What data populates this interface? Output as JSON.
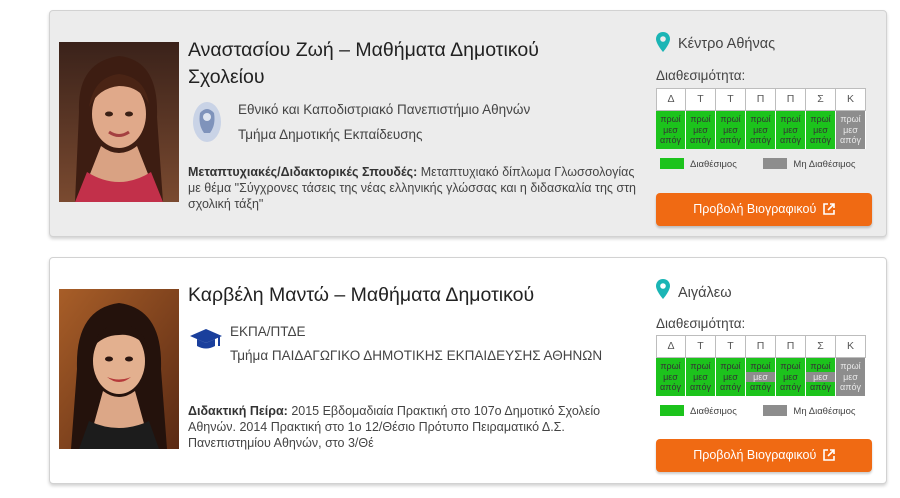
{
  "tutors": [
    {
      "name": "Αναστασίου Ζωή – Μαθήματα Δημοτικού Σχολείου",
      "university": "Εθνικό και Καποδιστριακό Πανεπιστήμιο Αθηνών",
      "department": "Τμήμα Δημοτικής Εκπαίδευσης",
      "description_label": "Μεταπτυχιακές/Διδακτορικές Σπουδές:",
      "description_text": " Μεταπτυχιακό δίπλωμα Γλωσσολογίας με θέμα \"Σύγχρονες τάσεις της νέας ελληνικής γλώσσας και η διδασκαλία της στη σχολική τάξη\"",
      "location": "Κέντρο Αθήνας",
      "availability_label": "Διαθεσιμότητα:",
      "days": [
        "Δ",
        "Τ",
        "Τ",
        "Π",
        "Π",
        "Σ",
        "Κ"
      ],
      "slots": [
        [
          "πρωί",
          "μεσ",
          "απόγ"
        ],
        [
          "πρωί",
          "μεσ",
          "απόγ"
        ],
        [
          "πρωί",
          "μεσ",
          "απόγ"
        ],
        [
          "πρωί",
          "μεσ",
          "απόγ"
        ],
        [
          "πρωί",
          "μεσ",
          "απόγ"
        ],
        [
          "πρωί",
          "μεσ",
          "απόγ"
        ],
        [
          "πρωί",
          "μεσ",
          "απόγ"
        ]
      ],
      "slot_states": [
        [
          1,
          1,
          1
        ],
        [
          1,
          1,
          1
        ],
        [
          1,
          1,
          1
        ],
        [
          1,
          1,
          1
        ],
        [
          1,
          1,
          1
        ],
        [
          1,
          1,
          1
        ],
        [
          0,
          0,
          0
        ]
      ],
      "legend_available": "Διαθέσιμος",
      "legend_unavailable": "Μη Διαθέσιμος",
      "button_label": "Προβολή Βιογραφικού"
    },
    {
      "name": "Καρβέλη Μαντώ – Μαθήματα Δημοτικού",
      "university": "ΕΚΠΑ/ΠΤΔΕ",
      "department": "Τμήμα ΠΑΙΔΑΓΩΓΙΚΟ ΔΗΜΟΤΙΚΗΣ ΕΚΠΑΙΔΕΥΣΗΣ ΑΘΗΝΩΝ",
      "description_label": "Διδακτική Πείρα:",
      "description_text": " 2015   Εβδομαδιαία Πρακτική στο 107ο Δημοτικό Σχολείο Αθηνών. 2014   Πρακτική στο 1ο 12/Θέσιο Πρότυπο Πειραματικό Δ.Σ. Πανεπιστημίου Αθηνών, στο 3/Θέ",
      "location": "Αιγάλεω",
      "availability_label": "Διαθεσιμότητα:",
      "days": [
        "Δ",
        "Τ",
        "Τ",
        "Π",
        "Π",
        "Σ",
        "Κ"
      ],
      "slots": [
        [
          "πρωί",
          "μεσ",
          "απόγ"
        ],
        [
          "πρωί",
          "μεσ",
          "απόγ"
        ],
        [
          "πρωί",
          "μεσ",
          "απόγ"
        ],
        [
          "πρωί",
          "μεσ",
          "απόγ"
        ],
        [
          "πρωί",
          "μεσ",
          "απόγ"
        ],
        [
          "πρωί",
          "μεσ",
          "απόγ"
        ],
        [
          "πρωί",
          "μεσ",
          "απόγ"
        ]
      ],
      "slot_states": [
        [
          1,
          1,
          1
        ],
        [
          1,
          1,
          1
        ],
        [
          1,
          1,
          1
        ],
        [
          1,
          0,
          1
        ],
        [
          1,
          1,
          1
        ],
        [
          1,
          0,
          1
        ],
        [
          0,
          0,
          0
        ]
      ],
      "legend_available": "Διαθέσιμος",
      "legend_unavailable": "Μη Διαθέσιμος",
      "button_label": "Προβολή Βιογραφικού"
    }
  ],
  "colors": {
    "available": "#1cc31c",
    "unavailable": "#8d8d8d",
    "button": "#f06a13",
    "location_pin": "#1bb5b5",
    "cap_icon": "#1a3f9c"
  },
  "icons": {
    "location": "map-marker-icon",
    "external": "external-link-icon",
    "university_1": "university-crest-icon",
    "university_2": "graduation-cap-icon"
  }
}
